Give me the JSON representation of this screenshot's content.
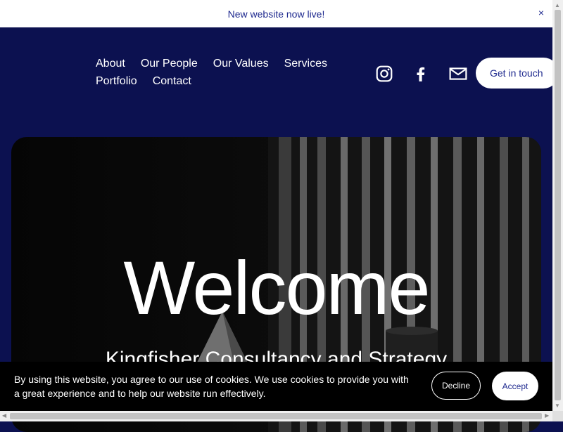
{
  "announcement": {
    "text": "New website now live!",
    "close": "×"
  },
  "nav": {
    "links": [
      "About",
      "Our People",
      "Our Values",
      "Services",
      "Portfolio",
      "Contact"
    ],
    "social": [
      "instagram-icon",
      "facebook-icon",
      "email-icon"
    ],
    "cta": "Get in touch"
  },
  "hero": {
    "title": "Welcome",
    "subtitle": "Kingfisher Consultancy and Strategy"
  },
  "cookie": {
    "message": "By using this website, you agree to our use of cookies. We use cookies to provide you with a great experience and to help our website run effectively.",
    "decline": "Decline",
    "accept": "Accept"
  },
  "colors": {
    "brand_navy": "#0c1150",
    "accent_text": "#1f2a8f"
  }
}
